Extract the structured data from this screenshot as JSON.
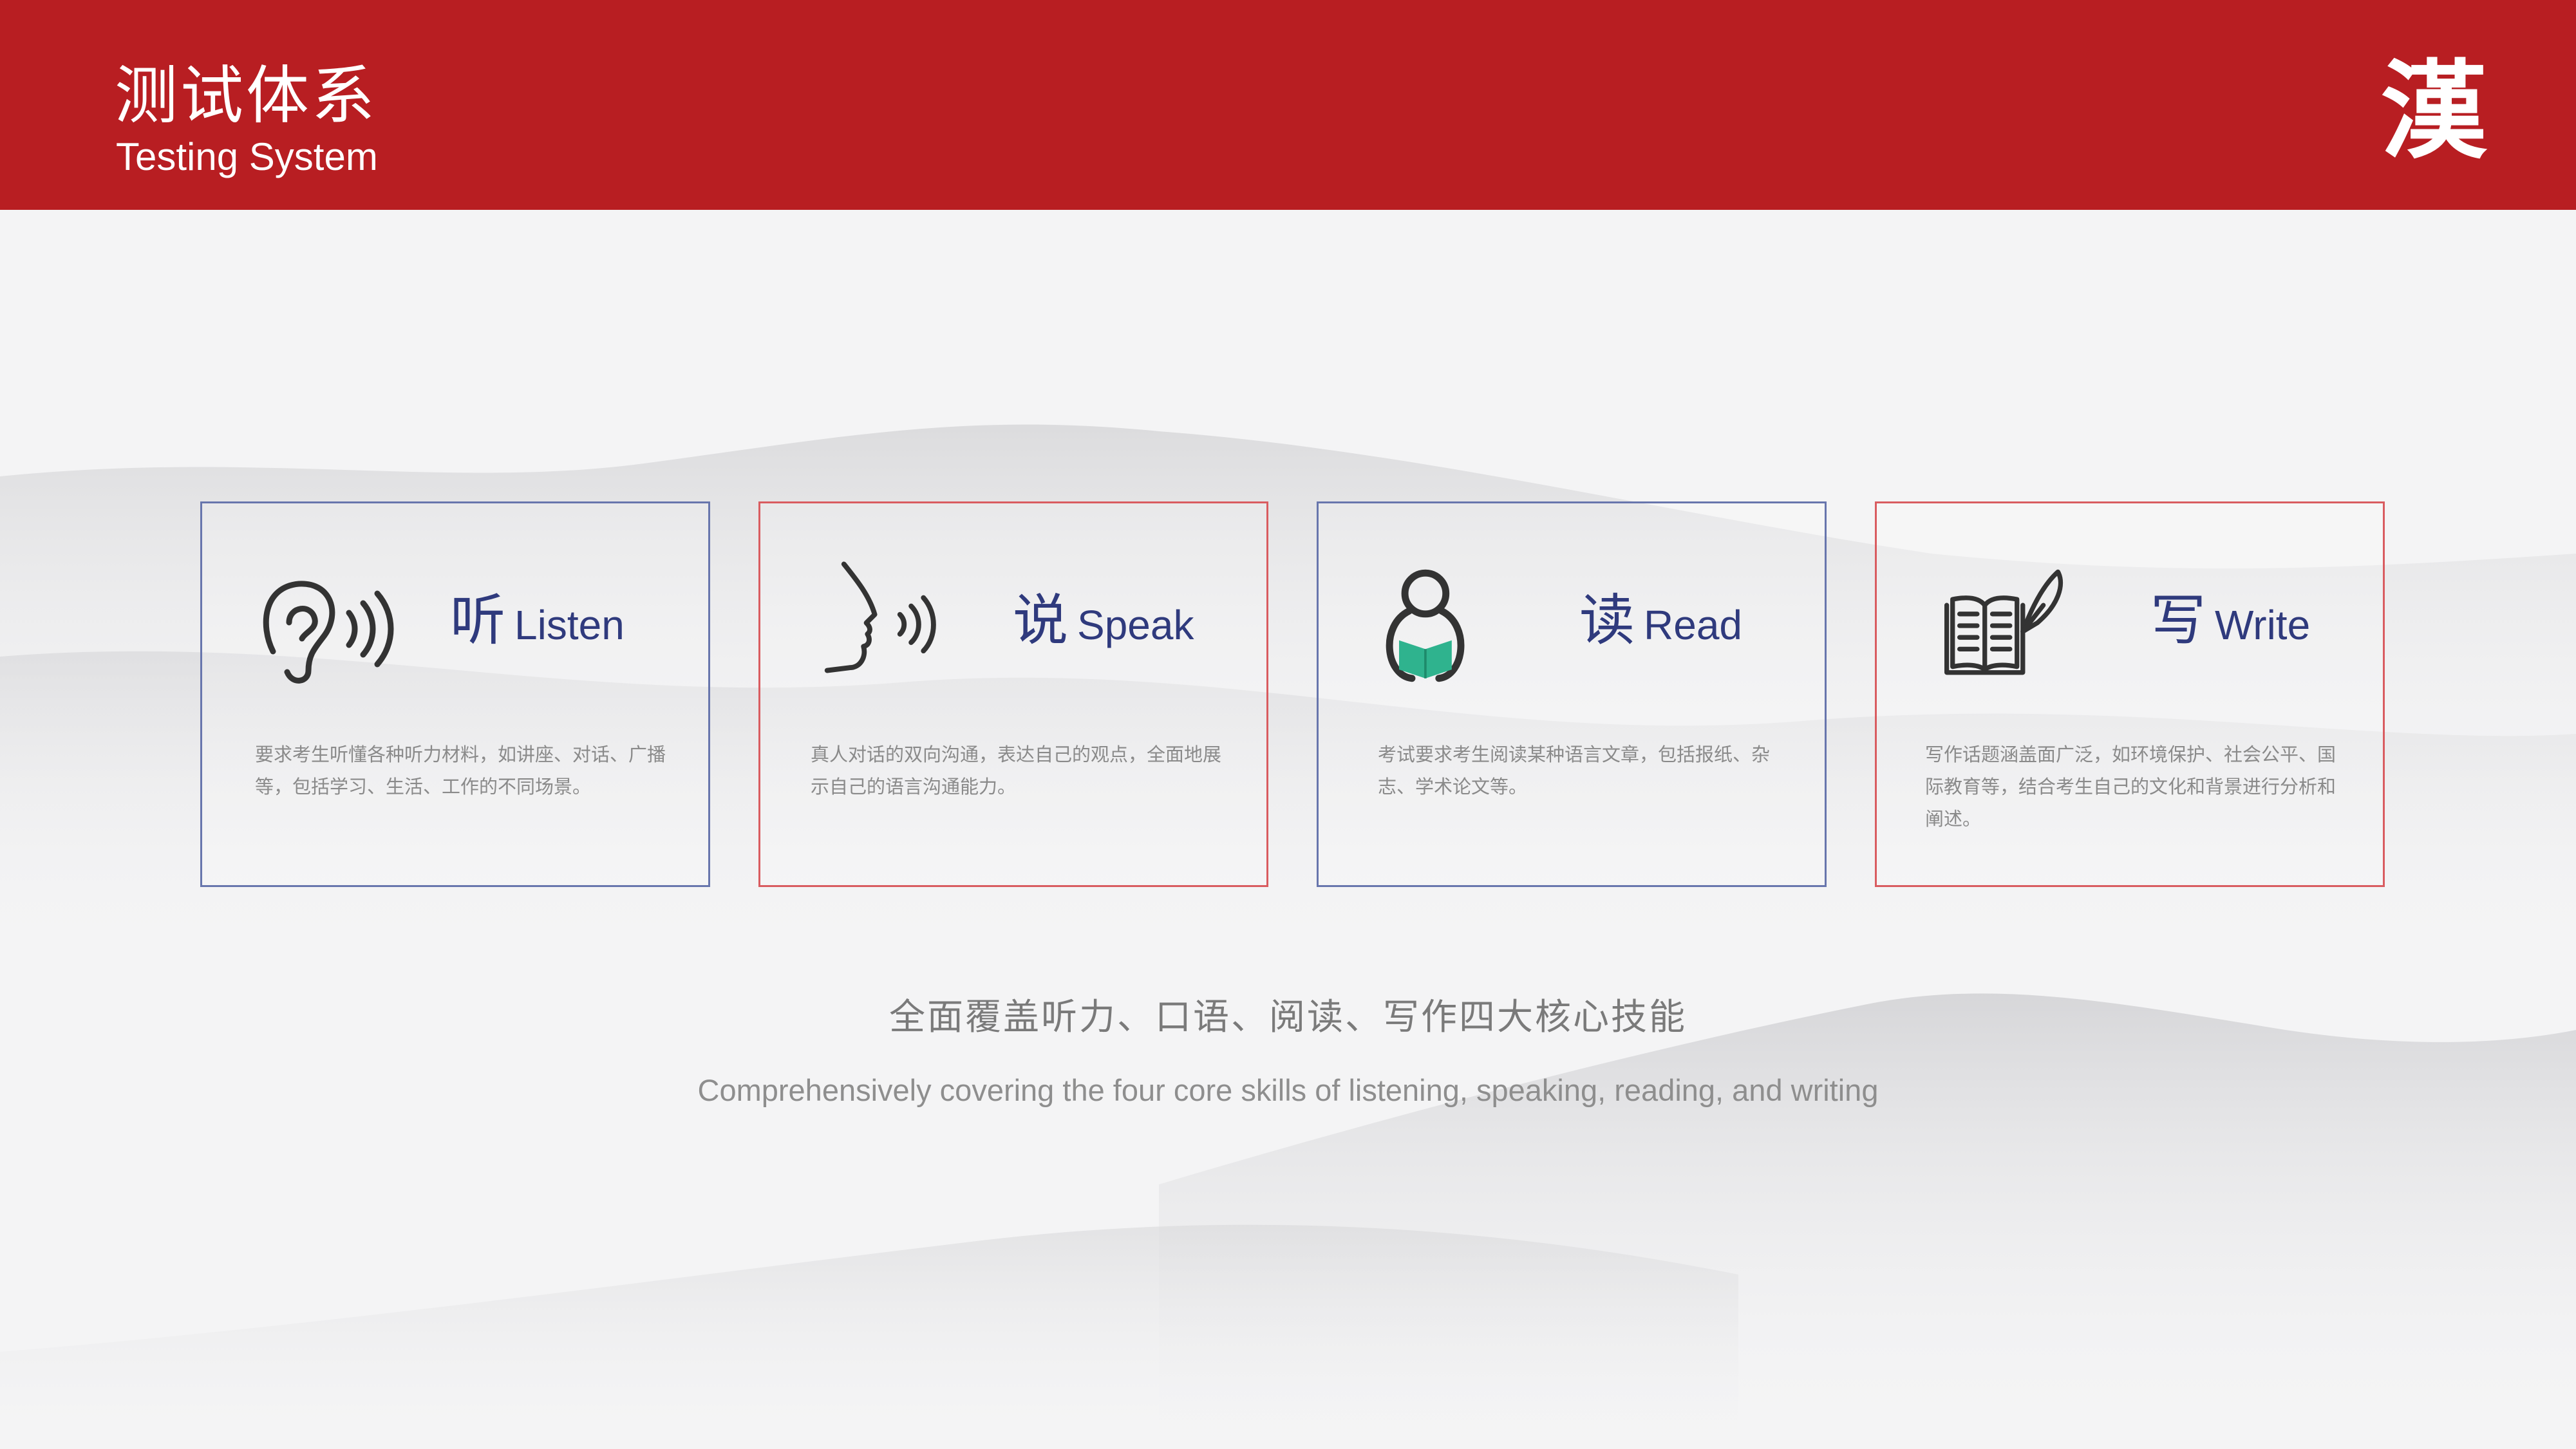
{
  "header": {
    "title_zh": "测试体系",
    "title_en": "Testing System",
    "logo_text": "漢",
    "bg_color": "#b81e22"
  },
  "cards": [
    {
      "icon": "ear-sound-icon",
      "char": "听",
      "label": "Listen",
      "desc": "要求考生听懂各种听力材料，如讲座、对话、广播等，包括学习、生活、工作的不同场景。",
      "border_color": "#6876ad"
    },
    {
      "icon": "speaking-face-icon",
      "char": "说",
      "label": "Speak",
      "desc": "真人对话的双向沟通，表达自己的观点，全面地展示自己的语言沟通能力。",
      "border_color": "#d95c60"
    },
    {
      "icon": "person-reading-book-icon",
      "char": "读",
      "label": "Read",
      "desc": "考试要求考生阅读某种语言文章，包括报纸、杂志、学术论文等。",
      "border_color": "#6876ad"
    },
    {
      "icon": "book-quill-icon",
      "char": "写",
      "label": "Write",
      "desc": "写作话题涵盖面广泛，如环境保护、社会公平、国际教育等，结合考生自己的文化和背景进行分析和阐述。",
      "border_color": "#d95c60"
    }
  ],
  "summary": {
    "zh": "全面覆盖听力、口语、阅读、写作四大核心技能",
    "en": "Comprehensively covering the four core skills of listening, speaking, reading, and writing"
  },
  "colors": {
    "accent_red": "#b81e22",
    "title_blue": "#2f3a7d",
    "book_green": "#2fb38e"
  }
}
